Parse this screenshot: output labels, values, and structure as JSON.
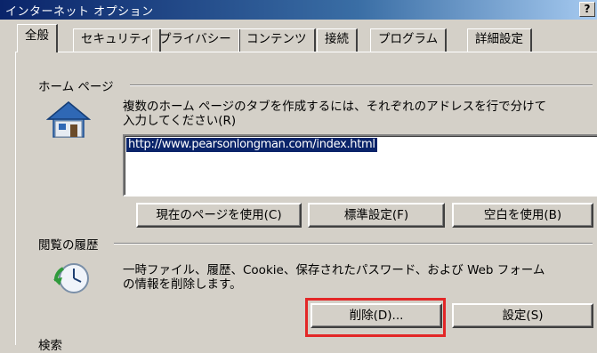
{
  "window": {
    "title": "インターネット オプション",
    "help_label": "?"
  },
  "tabs": [
    {
      "label": "全般",
      "active": true
    },
    {
      "label": "セキュリティ"
    },
    {
      "label": "プライバシー"
    },
    {
      "label": "コンテンツ"
    },
    {
      "label": "接続"
    },
    {
      "label": "プログラム"
    },
    {
      "label": "詳細設定"
    }
  ],
  "home_page": {
    "group_label": "ホーム ページ",
    "description_line1": "複数のホーム ページのタブを作成するには、それぞれのアドレスを行で分けて",
    "description_line2": "入力してください(R)",
    "url_value": "http://www.pearsonlongman.com/index.html",
    "buttons": {
      "use_current": "現在のページを使用(C)",
      "use_default": "標準設定(F)",
      "use_blank": "空白を使用(B)"
    },
    "icon": "house-icon"
  },
  "history": {
    "group_label": "閲覧の履歴",
    "description_line1": "一時ファイル、履歴、Cookie、保存されたパスワード、および Web フォーム",
    "description_line2": "の情報を削除します。",
    "buttons": {
      "delete": "削除(D)...",
      "settings": "設定(S)"
    },
    "icon": "history-clock-icon"
  },
  "search": {
    "group_label": "検索"
  },
  "colors": {
    "titlebar_start": "#0a246a",
    "highlight_box": "#e32727",
    "selection": "#0a246a"
  }
}
